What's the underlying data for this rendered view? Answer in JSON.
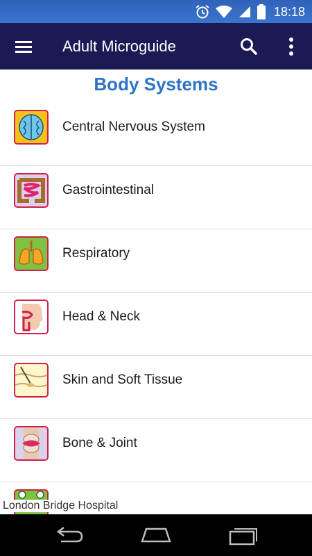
{
  "status_bar": {
    "time": "18:18",
    "icons": [
      "alarm-icon",
      "wifi-icon",
      "signal-icon",
      "battery-icon"
    ]
  },
  "app_bar": {
    "title": "Adult Microguide",
    "menu_icon": "hamburger-menu-icon",
    "search_icon": "search-icon",
    "more_icon": "more-vert-icon"
  },
  "main": {
    "section_title": "Body Systems",
    "items": [
      {
        "label": "Central Nervous System",
        "icon": "brain-icon"
      },
      {
        "label": "Gastrointestinal",
        "icon": "intestine-icon"
      },
      {
        "label": "Respiratory",
        "icon": "lungs-icon"
      },
      {
        "label": "Head & Neck",
        "icon": "head-neck-icon"
      },
      {
        "label": "Skin and Soft Tissue",
        "icon": "skin-icon"
      },
      {
        "label": "Bone & Joint",
        "icon": "bone-joint-icon"
      }
    ]
  },
  "footer": {
    "text": "London Bridge Hospital"
  },
  "nav_bar": {
    "icons": [
      "back-icon",
      "home-icon",
      "recent-apps-icon"
    ]
  },
  "colors": {
    "status_bar": "#3a74cf",
    "app_bar": "#1b1a55",
    "section_title": "#2d74c6",
    "icon_border": "#d0204a"
  }
}
